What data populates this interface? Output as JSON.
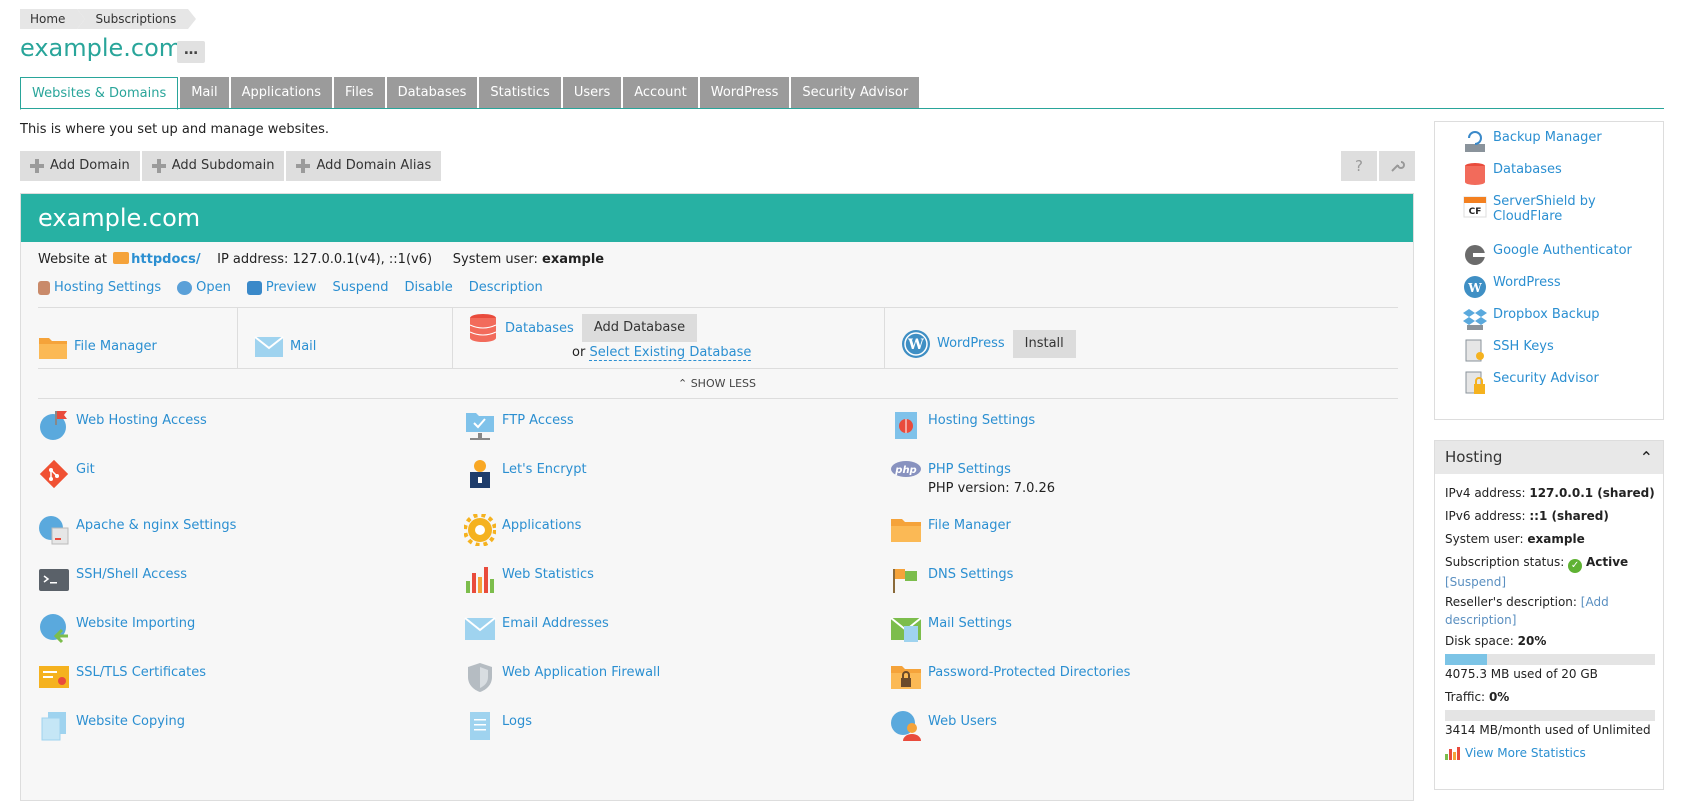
{
  "breadcrumb": [
    "Home",
    "Subscriptions"
  ],
  "page_title": "example.com",
  "title_menu": "…",
  "tabs": [
    "Websites & Domains",
    "Mail",
    "Applications",
    "Files",
    "Databases",
    "Statistics",
    "Users",
    "Account",
    "WordPress",
    "Security Advisor"
  ],
  "active_tab": "Websites & Domains",
  "intro": "This is where you set up and manage websites.",
  "toolbar": {
    "add_domain": "Add Domain",
    "add_subdomain": "Add Subdomain",
    "add_alias": "Add Domain Alias",
    "help": "?",
    "settings_icon": "wrench-icon"
  },
  "domain": {
    "name": "example.com",
    "website_at": "Website at",
    "docroot": "httpdocs/",
    "ip_label": "IP address:",
    "ip_value": "127.0.0.1(v4), ::1(v6)",
    "sysuser_label": "System user:",
    "sysuser_value": "example",
    "actions": {
      "hosting": "Hosting Settings",
      "open": "Open",
      "preview": "Preview",
      "suspend": "Suspend",
      "disable": "Disable",
      "description": "Description"
    },
    "tiles": {
      "file_manager": "File Manager",
      "mail": "Mail",
      "databases": "Databases",
      "add_database": "Add Database",
      "or": "or",
      "select_db": "Select Existing Database",
      "wordpress": "WordPress",
      "install": "Install"
    },
    "show_less": "SHOW LESS",
    "tools": [
      {
        "label": "Web Hosting Access"
      },
      {
        "label": "FTP Access"
      },
      {
        "label": "Hosting Settings"
      },
      {
        "label": "Git"
      },
      {
        "label": "Let's Encrypt"
      },
      {
        "label": "PHP Settings",
        "sub": "PHP version: 7.0.26"
      },
      {
        "label": "Apache & nginx Settings"
      },
      {
        "label": "Applications"
      },
      {
        "label": "File Manager"
      },
      {
        "label": "SSH/Shell Access"
      },
      {
        "label": "Web Statistics"
      },
      {
        "label": "DNS Settings"
      },
      {
        "label": "Website Importing"
      },
      {
        "label": "Email Addresses"
      },
      {
        "label": "Mail Settings"
      },
      {
        "label": "SSL/TLS Certificates"
      },
      {
        "label": "Web Application Firewall"
      },
      {
        "label": "Password-Protected Directories"
      },
      {
        "label": "Website Copying"
      },
      {
        "label": "Logs"
      },
      {
        "label": "Web Users"
      }
    ]
  },
  "sidebar": {
    "links": [
      "Backup Manager",
      "Databases",
      "ServerShield by CloudFlare",
      "Google Authenticator",
      "WordPress",
      "Dropbox Backup",
      "SSH Keys",
      "Security Advisor"
    ]
  },
  "hosting": {
    "title": "Hosting",
    "ipv4_label": "IPv4 address:",
    "ipv4_value": "127.0.0.1 (shared)",
    "ipv6_label": "IPv6 address:",
    "ipv6_value": "::1 (shared)",
    "sysuser_label": "System user:",
    "sysuser_value": "example",
    "status_label": "Subscription status:",
    "status_value": "Active",
    "suspend_link": "[Suspend]",
    "reseller_label": "Reseller's description:",
    "reseller_link": "[Add description]",
    "disk_label": "Disk space:",
    "disk_value": "20%",
    "disk_fraction": 0.2,
    "disk_used": "4075.3 MB used of 20 GB",
    "traffic_label": "Traffic:",
    "traffic_value": "0%",
    "traffic_fraction": 0,
    "traffic_used": "3414 MB/month used of Unlimited",
    "more_stats": "View More Statistics"
  },
  "colors": {
    "brand": "#29a59a",
    "header_bg": "#27b1a3",
    "link": "#2b8fd1",
    "tab_inactive": "#9b9b9b"
  }
}
